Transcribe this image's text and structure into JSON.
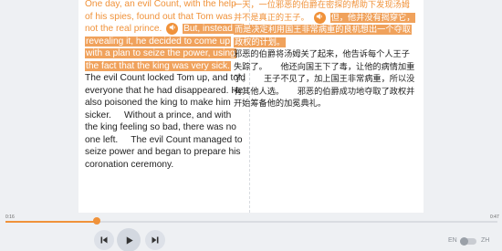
{
  "reader": {
    "english": {
      "p1_plain": "One day, an evil Count, with the help of his spies, found out that Tom was not the real prince.",
      "p1_highlight": "But, instead of revealing it, he decided to come up with a plan to seize the power, using the fact that the king was very sick.",
      "p2": "The evil Count locked Tom up, and told everyone that he had disappeared.",
      "p3": "He also poisoned the king to make him sicker.",
      "p3b": "Without a prince, and with the king feeling so bad, there was no one left.",
      "p3c": "The evil Count managed to seize power and began to prepare his coronation ceremony."
    },
    "chinese": {
      "p1_plain": "一天，一位邪恶的伯爵在密探的帮助下发现汤姆并不是真正的王子。",
      "p1_highlight": "但，他并没有揭穿它，而是决定利用国王非常病重的良机想出一个夺取政权的计划。",
      "p2": "邪恶的伯爵将汤姆关了起来，他告诉每个人王子失踪了。",
      "p3": "他还向国王下了毒，让他的病情加重了。",
      "p3b": "王子不见了，加上国王非常病重，所以没有其他人选。",
      "p3c": "邪恶的伯爵成功地夺取了政权并开始筹备他的加冕典礼。"
    }
  },
  "player": {
    "elapsed": "0:16",
    "total": "0:47",
    "progress": 0.185,
    "lang_left": "EN",
    "lang_right": "ZH",
    "speaker_icon": "speaker-icon"
  },
  "colors": {
    "accent": "#f0923a",
    "highlight": "#f0a25c"
  }
}
